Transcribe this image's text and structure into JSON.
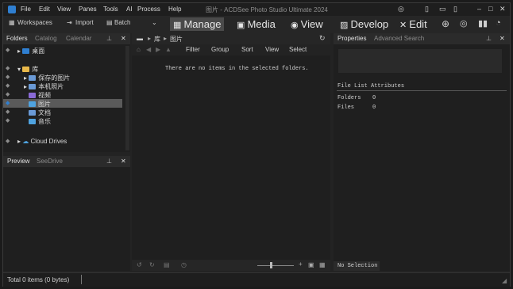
{
  "menu": {
    "app_icon": "acdsee-logo-icon",
    "items": [
      "File",
      "Edit",
      "View",
      "Panes",
      "Tools",
      "AI",
      "Process",
      "Help"
    ],
    "window_title": "图片 - ACDSee Photo Studio Ultimate 2024"
  },
  "toolbar": {
    "workspaces": "Workspaces",
    "import": "Import",
    "batch": "Batch",
    "modes": [
      "Manage",
      "Media",
      "View",
      "Develop",
      "Edit"
    ],
    "active_mode": "Manage"
  },
  "left_panel": {
    "tabs": [
      "Folders",
      "Catalog",
      "Calendar"
    ],
    "tree": [
      {
        "label": "桌面",
        "indent": 0
      },
      {
        "label": "库",
        "indent": 0
      },
      {
        "label": "保存的图片",
        "indent": 1
      },
      {
        "label": "本机照片",
        "indent": 1
      },
      {
        "label": "视频",
        "indent": 1
      },
      {
        "label": "图片",
        "indent": 1
      },
      {
        "label": "文档",
        "indent": 1
      },
      {
        "label": "音乐",
        "indent": 1
      },
      {
        "label": "Cloud Drives",
        "indent": 0
      }
    ],
    "preview_tabs": [
      "Preview",
      "SeeDrive"
    ]
  },
  "center": {
    "breadcrumb": [
      "库",
      "图片"
    ],
    "filter_bar": [
      "Filter",
      "Group",
      "Sort",
      "View",
      "Select"
    ],
    "empty_message": "There are no items in the selected folders."
  },
  "right_panel": {
    "tabs": [
      "Properties",
      "Advanced Search"
    ],
    "section_title": "File List Attributes",
    "attributes": [
      {
        "label": "Folders",
        "value": "0"
      },
      {
        "label": "Files",
        "value": "0"
      }
    ],
    "footer": "No Selection"
  },
  "status": {
    "text": "Total 0 items  (0 bytes)"
  },
  "colors": {
    "background": "#232323",
    "panel": "#1f1f1f",
    "selection": "#5a5a5a",
    "accent_blue": "#2f7fd1",
    "folder_yellow": "#e8b84a"
  }
}
